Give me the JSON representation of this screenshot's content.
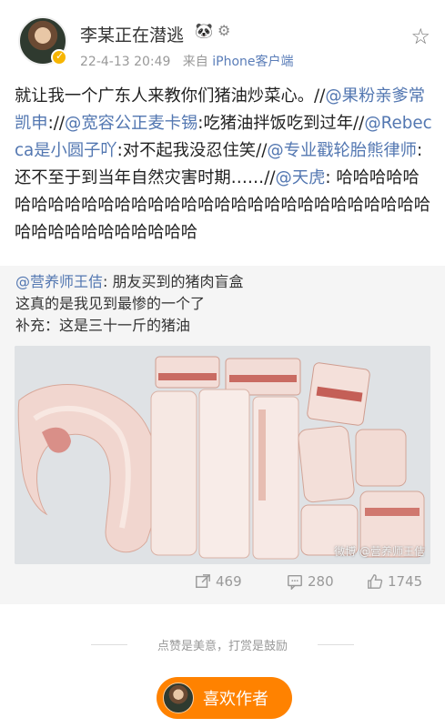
{
  "header": {
    "username": "李某正在潜逃",
    "name_icons": "🐼 ⚙",
    "timestamp": "22-4-13 20:49",
    "source_prefix": "来自",
    "source_device": "iPhone客户端"
  },
  "content": {
    "lead": "就让我一个广东人来教你们猪油炒菜心。//",
    "m1": "@果粉亲爹常凯申",
    "t1": "://",
    "m2": "@宽容公正麦卡锡",
    "t2": ":吃猪油拌饭吃到过年//",
    "m3": "@Rebecca是小圆子吖",
    "t3": ":对不起我没忍住笑//",
    "m4": "@专业戳轮胎熊律师",
    "t4": ":还不至于到当年自然灾害时期……//",
    "m5": "@天虎",
    "t5": ": 哈哈哈哈哈哈哈哈哈哈哈哈哈哈哈哈哈哈哈哈哈哈哈哈哈哈哈哈哈哈哈哈哈哈哈哈哈哈哈哈哈"
  },
  "repost": {
    "author": "@营养师王佶",
    "line1": ": 朋友买到的猪肉盲盒",
    "line2": "这真的是我见到最惨的一个了",
    "line3": "补充：这是三十一斤的猪油",
    "watermark": "微博 @营养师王佶"
  },
  "actions": {
    "repost_count": "469",
    "comment_count": "280",
    "like_count": "1745"
  },
  "footer": {
    "tip": "点赞是美意，打赏是鼓励",
    "like_author_label": "喜欢作者"
  },
  "colors": {
    "mention": "#5377b1",
    "accent": "#ff8200",
    "repost_bg": "#f5f5f5"
  }
}
